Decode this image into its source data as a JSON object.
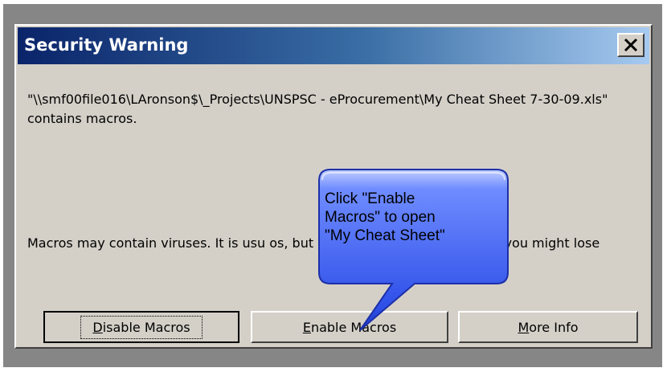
{
  "window": {
    "title": "Security Warning",
    "close_glyph": "✕"
  },
  "message": {
    "path_text": "\"\\\\smf00file016\\LAronson$\\_Projects\\UNSPSC - eProcurement\\My Cheat Sheet 7-30-09.xls\" contains macros.",
    "warning_text": "Macros may contain viruses. It is usu                               os, but if the macros are legitimate, you might lose"
  },
  "buttons": {
    "disable": {
      "mnemonic": "D",
      "rest": "isable Macros"
    },
    "enable": {
      "mnemonic": "E",
      "rest": "nable Macros"
    },
    "more": {
      "mnemonic": "M",
      "rest": "ore Info"
    }
  },
  "callout": {
    "line1": "Click \"Enable",
    "line2": "Macros\" to open",
    "line3": "\"My Cheat Sheet\""
  },
  "colors": {
    "dialog_bg": "#d4d0c8",
    "titlebar_start": "#0a246a",
    "titlebar_end": "#a6caf0",
    "callout_fill": "#3a60f0",
    "callout_highlight": "#b8c6ff"
  }
}
